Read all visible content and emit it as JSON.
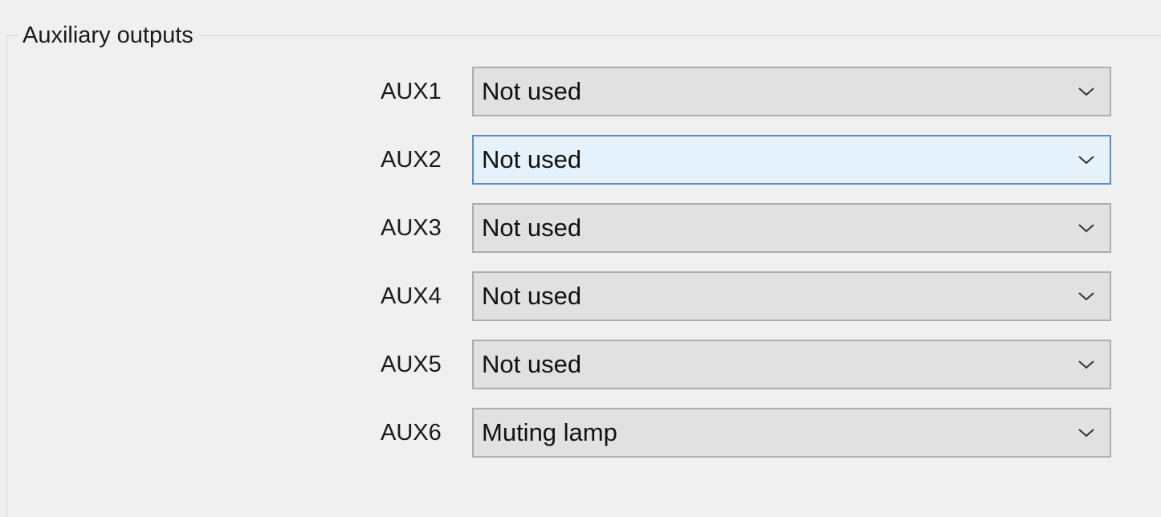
{
  "group": {
    "title": "Auxiliary outputs"
  },
  "aux_rows": [
    {
      "label": "AUX1",
      "value": "Not used",
      "focused": false
    },
    {
      "label": "AUX2",
      "value": "Not used",
      "focused": true
    },
    {
      "label": "AUX3",
      "value": "Not used",
      "focused": false
    },
    {
      "label": "AUX4",
      "value": "Not used",
      "focused": false
    },
    {
      "label": "AUX5",
      "value": "Not used",
      "focused": false
    },
    {
      "label": "AUX6",
      "value": "Muting lamp",
      "focused": false
    }
  ],
  "colors": {
    "focus_border": "#5b8ec9",
    "focus_fill": "#e5f1fb",
    "combo_fill": "#e1e1e1",
    "combo_border": "#adadad"
  },
  "icons": {
    "dropdown": "chevron-down-icon"
  }
}
